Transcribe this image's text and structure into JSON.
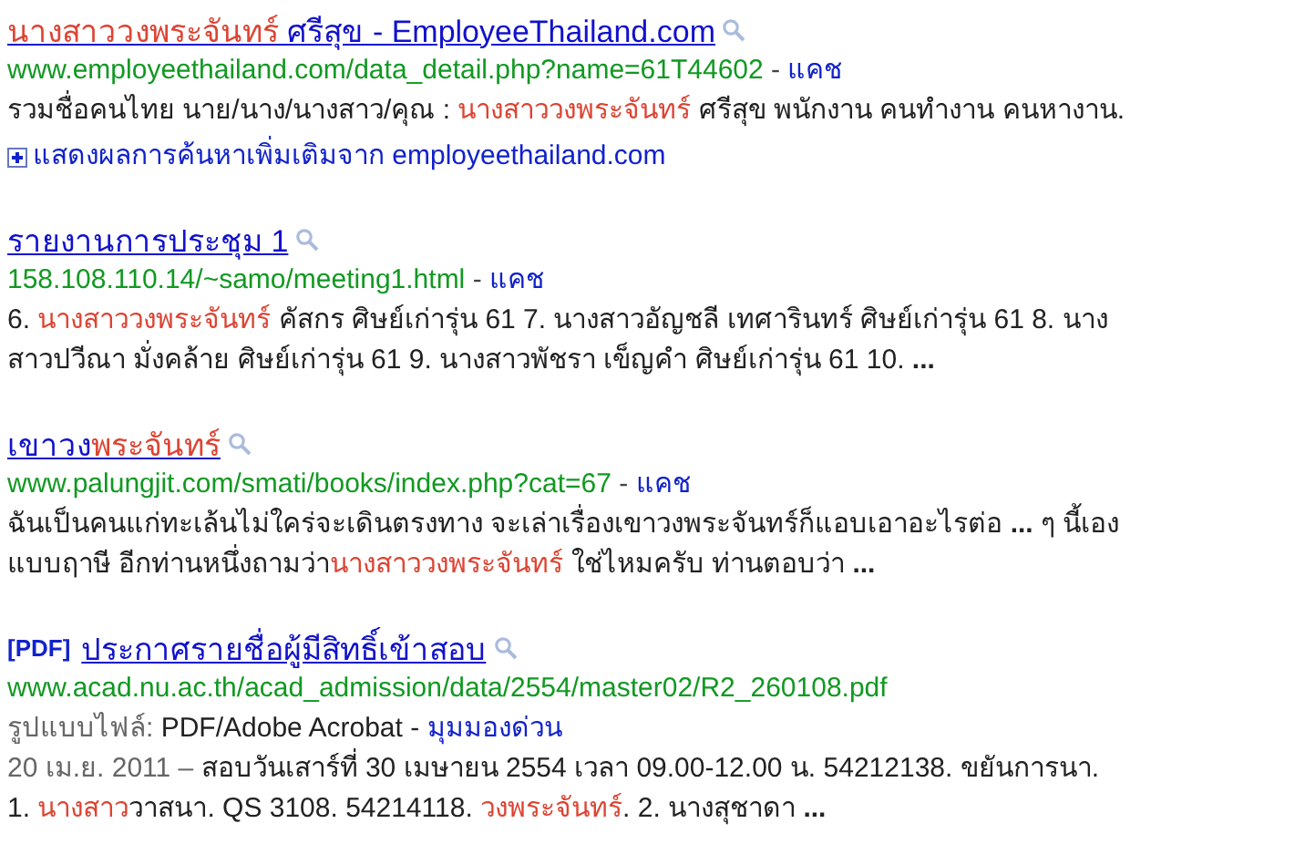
{
  "results": [
    {
      "title": [
        {
          "text": "นางสาววงพระจันทร์",
          "highlight": true
        },
        {
          "text": " ศรีสุข - EmployeeThailand.com",
          "highlight": false
        }
      ],
      "url": "www.employeethailand.com/data_detail.php?name=61T44602",
      "separator": "-",
      "cache": "แคช",
      "snippet": [
        [
          {
            "text": "รวมชื่อคนไทย นาย/นาง/นางสาว/คุณ : ",
            "highlight": false
          },
          {
            "text": "นางสาววงพระจันทร์",
            "highlight": true
          },
          {
            "text": " ศรีสุข พนักงาน คนทำงาน คนหางาน.",
            "highlight": false
          }
        ]
      ],
      "more": "แสดงผลการค้นหาเพิ่มเติมจาก employeethailand.com"
    },
    {
      "title": [
        {
          "text": "รายงานการประชุม 1",
          "highlight": false
        }
      ],
      "url": "158.108.110.14/~samo/meeting1.html",
      "separator": "-",
      "cache": "แคช",
      "snippet": [
        [
          {
            "text": "6. ",
            "highlight": false
          },
          {
            "text": "นางสาววงพระจันทร์",
            "highlight": true
          },
          {
            "text": " คัสกร ศิษย์เก่ารุ่น 61 7. นางสาวอัญชลี เทศารินทร์ ศิษย์เก่ารุ่น 61 8. นาง",
            "highlight": false
          }
        ],
        [
          {
            "text": "สาวปวีณา มั่งคล้าย ศิษย์เก่ารุ่น 61 9. นางสาวพัชรา เข็ญคำ ศิษย์เก่ารุ่น 61 10. **...**",
            "highlight": false
          }
        ]
      ]
    },
    {
      "title": [
        {
          "text": "เขาวง",
          "highlight": false
        },
        {
          "text": "พระจันทร์",
          "highlight": true
        }
      ],
      "url": "www.palungjit.com/smati/books/index.php?cat=67",
      "separator": "-",
      "cache": "แคช",
      "snippet": [
        [
          {
            "text": "ฉันเป็นคนแก่ทะเล้นไม่ใคร่จะเดินตรงทาง จะเล่าเรื่องเขาวงพระจันทร์ก็แอบเอาอะไรต่อ **...** ๆ นี้เอง",
            "highlight": false
          }
        ],
        [
          {
            "text": "แบบฤาษี อีกท่านหนึ่งถามว่า",
            "highlight": false
          },
          {
            "text": "นางสาววงพระจันทร์",
            "highlight": true
          },
          {
            "text": " ใช่ไหมครับ ท่านตอบว่า **...**",
            "highlight": false
          }
        ]
      ]
    },
    {
      "pdf_tag": "[PDF]",
      "title": [
        {
          "text": "ประกาศรายชื่อผู้มีสิทธิ์เข้าสอบ",
          "highlight": false
        }
      ],
      "url": "www.acad.nu.ac.th/acad_admission/data/2554/master02/R2_260108.pdf",
      "file_type": {
        "label": "รูปแบบไฟล์:",
        "value": "PDF/Adobe Acrobat -",
        "link": "มุมมองด่วน"
      },
      "date": "20 เม.ย. 2011 –",
      "snippet": [
        [
          {
            "text": "สอบวันเสาร์ที่ 30 เมษายน 2554 เวลา 09.00-12.00 น. 54212138. ขยันการนา.",
            "highlight": false
          }
        ],
        [
          {
            "text": "1. ",
            "highlight": false
          },
          {
            "text": "นางสาว",
            "highlight": true
          },
          {
            "text": "วาสนา. QS 3108. 54214118. ",
            "highlight": false
          },
          {
            "text": "วงพระจันทร์",
            "highlight": true
          },
          {
            "text": ". 2. นางสุชาดา **...**",
            "highlight": false
          }
        ]
      ]
    }
  ]
}
